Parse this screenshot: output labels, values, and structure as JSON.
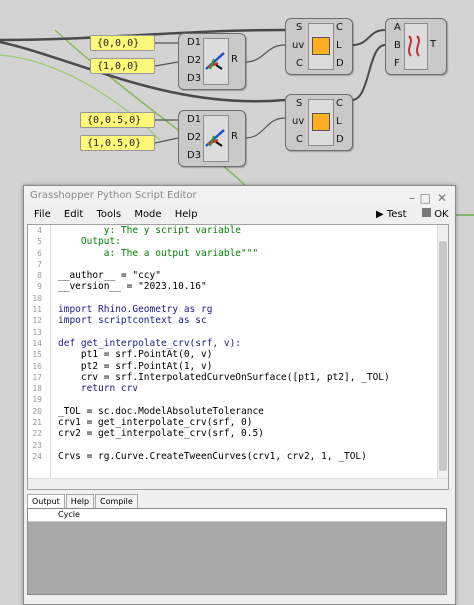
{
  "canvas": {
    "panels": [
      "{0,0,0}",
      "{1,0,0}",
      "{0,0.5,0}",
      "{1,0.5,0}"
    ],
    "comp1": {
      "inputs": [
        "D1",
        "D2",
        "D3"
      ],
      "output": "R"
    },
    "comp2": {
      "inputs": [
        "D1",
        "D2",
        "D3"
      ],
      "output": "R"
    },
    "eval1": {
      "inputs": [
        "S",
        "uv",
        "C"
      ],
      "outputs": [
        "C",
        "L",
        "D"
      ]
    },
    "eval2": {
      "inputs": [
        "S",
        "uv",
        "C"
      ],
      "outputs": [
        "C",
        "L",
        "D"
      ]
    },
    "loft": {
      "inputs": [
        "A",
        "B",
        "F"
      ],
      "output": "T"
    }
  },
  "editor": {
    "title": "Grasshopper Python Script Editor",
    "menu": [
      "File",
      "Edit",
      "Tools",
      "Mode",
      "Help"
    ],
    "test_label": "Test",
    "ok_label": "OK",
    "code_lines": [
      {
        "n": "4",
        "t": "        y: The y script variable"
      },
      {
        "n": "5",
        "t": "    Output:"
      },
      {
        "n": "6",
        "t": "        a: The a output variable\"\"\""
      },
      {
        "n": "7",
        "t": ""
      },
      {
        "n": "8",
        "t": "__author__ = \"ccy\""
      },
      {
        "n": "9",
        "t": "__version__ = \"2023.10.16\""
      },
      {
        "n": "10",
        "t": ""
      },
      {
        "n": "11",
        "t": "import Rhino.Geometry as rg"
      },
      {
        "n": "12",
        "t": "import scriptcontext as sc"
      },
      {
        "n": "13",
        "t": ""
      },
      {
        "n": "14",
        "t": "def get_interpolate_crv(srf, v):"
      },
      {
        "n": "15",
        "t": "    pt1 = srf.PointAt(0, v)"
      },
      {
        "n": "16",
        "t": "    pt2 = srf.PointAt(1, v)"
      },
      {
        "n": "17",
        "t": "    crv = srf.InterpolatedCurveOnSurface([pt1, pt2], _TOL)"
      },
      {
        "n": "18",
        "t": "    return crv"
      },
      {
        "n": "19",
        "t": ""
      },
      {
        "n": "20",
        "t": "_TOL = sc.doc.ModelAbsoluteTolerance"
      },
      {
        "n": "21",
        "t": "crv1 = get_interpolate_crv(srf, 0)"
      },
      {
        "n": "22",
        "t": "crv2 = get_interpolate_crv(srf, 0.5)"
      },
      {
        "n": "23",
        "t": ""
      },
      {
        "n": "24",
        "t": "Crvs = rg.Curve.CreateTweenCurves(crv1, crv2, 1, _TOL)"
      }
    ],
    "tabs": [
      "Output",
      "Help",
      "Compile"
    ],
    "output_header": "Cycle"
  }
}
